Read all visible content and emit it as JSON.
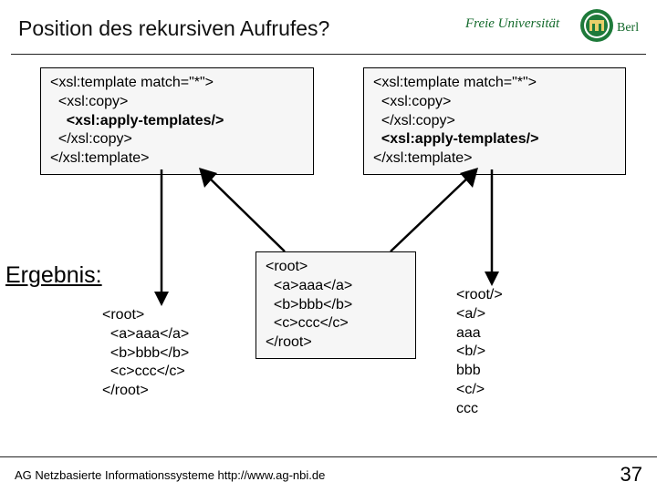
{
  "slide": {
    "title": "Position des rekursiven Aufrufes?",
    "logo_text_top": "Freie Universität",
    "logo_text_side": "Berlin"
  },
  "codeA": {
    "l1": "<xsl:template match=\"*\">",
    "l2": "  <xsl:copy>",
    "l3": "    <xsl:apply-templates/>",
    "l4": "  </xsl:copy>",
    "l5": "</xsl:template>"
  },
  "codeB": {
    "l1": "<xsl:template match=\"*\">",
    "l2": "  <xsl:copy>",
    "l3": "  </xsl:copy>",
    "l4": "  <xsl:apply-templates/>",
    "l5": "</xsl:template>"
  },
  "input": {
    "l1": "<root>",
    "l2": "  <a>aaa</a>",
    "l3": "  <b>bbb</b>",
    "l4": "  <c>ccc</c>",
    "l5": "</root>"
  },
  "result_label": "Ergebnis:",
  "out1": {
    "l1": "<root>",
    "l2": "  <a>aaa</a>",
    "l3": "  <b>bbb</b>",
    "l4": "  <c>ccc</c>",
    "l5": "</root>"
  },
  "out2": {
    "l1": "<root/>",
    "l2": "<a/>",
    "l3": "aaa",
    "l4": "<b/>",
    "l5": "bbb",
    "l6": "<c/>",
    "l7": "ccc"
  },
  "footer": {
    "text": "AG Netzbasierte Informationssysteme http://www.ag-nbi.de",
    "page": "37"
  }
}
